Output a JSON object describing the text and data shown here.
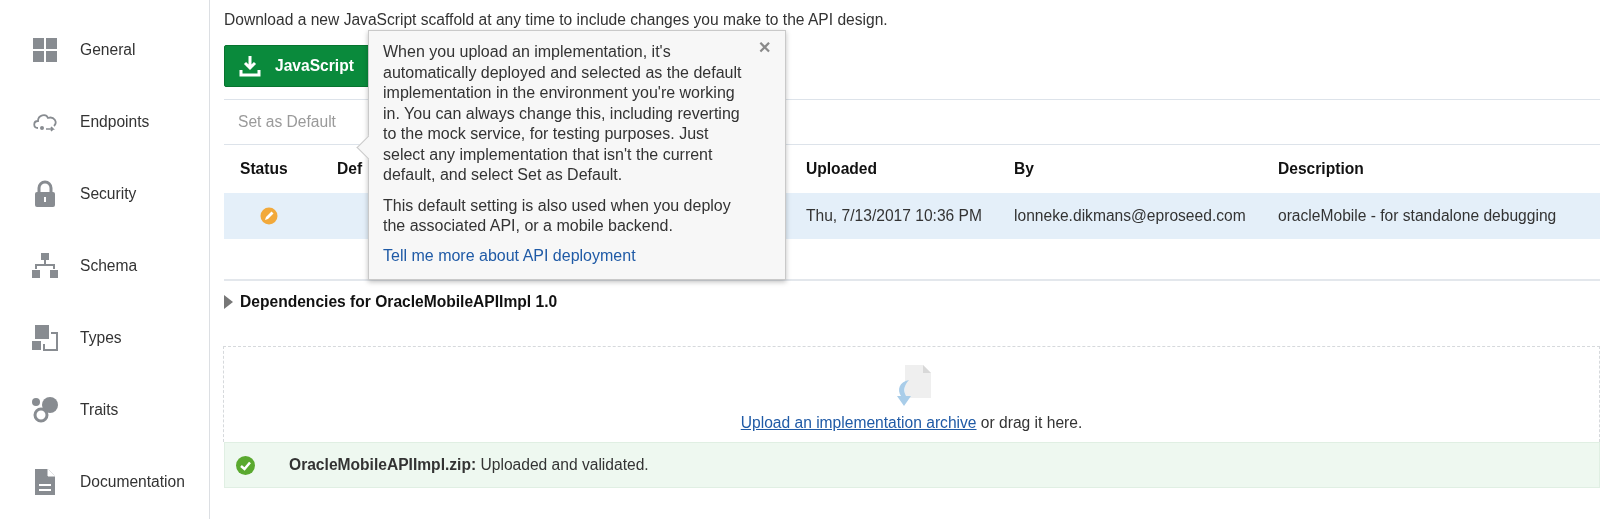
{
  "sidebar": {
    "items": [
      {
        "kind": "grid",
        "label": "General"
      },
      {
        "kind": "cloud",
        "label": "Endpoints"
      },
      {
        "kind": "lock",
        "label": "Security"
      },
      {
        "kind": "hierarchy",
        "label": "Schema"
      },
      {
        "kind": "types",
        "label": "Types"
      },
      {
        "kind": "traits",
        "label": "Traits"
      },
      {
        "kind": "document",
        "label": "Documentation"
      }
    ]
  },
  "intro": "Download a new JavaScript scaffold at any time to include changes you make to the API design.",
  "download_button": {
    "label": "JavaScript"
  },
  "toolbar": {
    "set_default": {
      "label": "Set as Default",
      "disabled": true
    }
  },
  "table": {
    "columns": [
      "Status",
      "Def",
      "Uploaded",
      "By",
      "Description"
    ],
    "rows": [
      {
        "selected": true,
        "kind": "edit",
        "uploaded": "Thu, 7/13/2017 10:36 PM",
        "by": "lonneke.dikmans@eproseed.com",
        "description": "oracleMobile - for standalone debugging"
      }
    ]
  },
  "dependencies": {
    "label": "Dependencies for OracleMobileAPIImpl 1.0",
    "expanded": false
  },
  "dropzone": {
    "link": "Upload an implementation archive",
    "text": " or drag it here."
  },
  "message": {
    "kind": "success",
    "file": "OracleMobileAPIImpl.zip:",
    "text": " Uploaded and validated."
  },
  "popover": {
    "close": "✕",
    "paragraphs": [
      "When you upload an implementation, it's automatically deployed and selected as the default implementation in the environment you're working in. You can always change this, including reverting to the mock service, for testing purposes. Just select any implementation that isn't the current default, and select Set as Default.",
      "This default setting is also used when you deploy the associated API, or a mobile backend."
    ],
    "link": "Tell me more about API deployment"
  }
}
